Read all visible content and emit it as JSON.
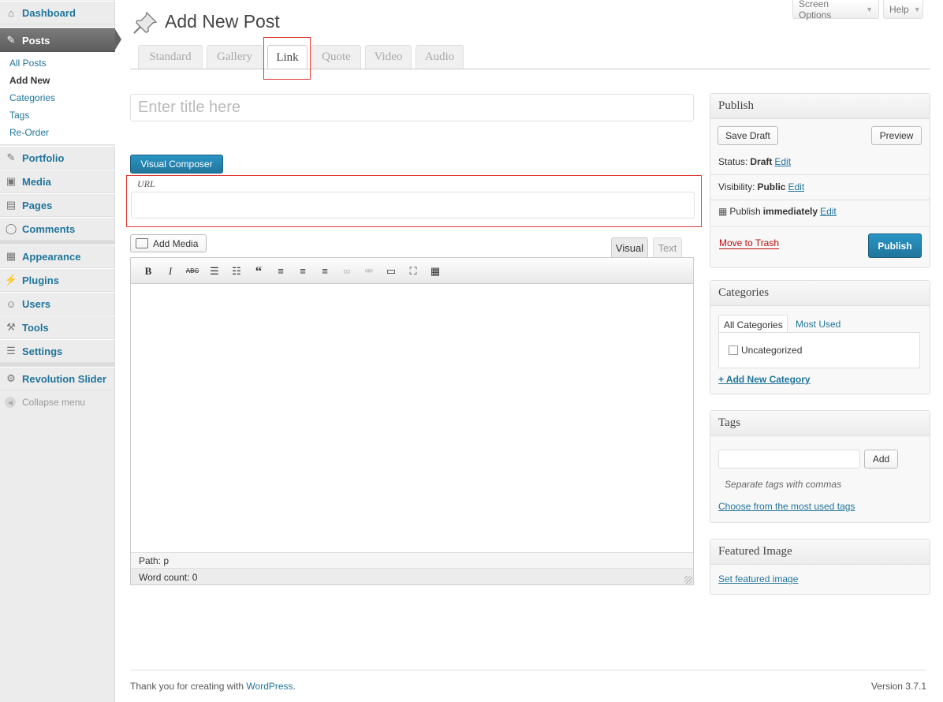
{
  "menu": {
    "dashboard": "Dashboard",
    "posts": "Posts",
    "submenu": [
      "All Posts",
      "Add New",
      "Categories",
      "Tags",
      "Re-Order"
    ],
    "portfolio": "Portfolio",
    "media": "Media",
    "pages": "Pages",
    "comments": "Comments",
    "appearance": "Appearance",
    "plugins": "Plugins",
    "users": "Users",
    "tools": "Tools",
    "settings": "Settings",
    "revolution_slider": "Revolution Slider",
    "collapse": "Collapse menu"
  },
  "top": {
    "screen_options": "Screen Options",
    "help": "Help"
  },
  "page_title": "Add New Post",
  "format_tabs": [
    "Standard",
    "Gallery",
    "Link",
    "Quote",
    "Video",
    "Audio"
  ],
  "active_format": "Link",
  "title_placeholder": "Enter title here",
  "visual_composer": "Visual Composer",
  "url_label": "URL",
  "editor": {
    "add_media": "Add Media",
    "tab_visual": "Visual",
    "tab_text": "Text",
    "path": "Path: p",
    "word_count": "Word count: 0"
  },
  "publish": {
    "title": "Publish",
    "save_draft": "Save Draft",
    "preview": "Preview",
    "status_label": "Status:",
    "status_value": "Draft",
    "visibility_label": "Visibility:",
    "visibility_value": "Public",
    "publish_label": "Publish",
    "publish_value": "immediately",
    "edit": "Edit",
    "move_to_trash": "Move to Trash",
    "publish_button": "Publish"
  },
  "categories": {
    "title": "Categories",
    "tab_all": "All Categories",
    "tab_most_used": "Most Used",
    "items": [
      "Uncategorized"
    ],
    "add_new": "+ Add New Category"
  },
  "tags": {
    "title": "Tags",
    "add": "Add",
    "hint": "Separate tags with commas",
    "choose": "Choose from the most used tags"
  },
  "featured_image": {
    "title": "Featured Image",
    "set": "Set featured image"
  },
  "footer": {
    "thanks": "Thank you for creating with",
    "wordpress": "WordPress",
    "period": ".",
    "version": "Version 3.7.1"
  },
  "colors": {
    "accent": "#21759b",
    "highlight": "#e53935",
    "trash": "#bc0b0b"
  }
}
